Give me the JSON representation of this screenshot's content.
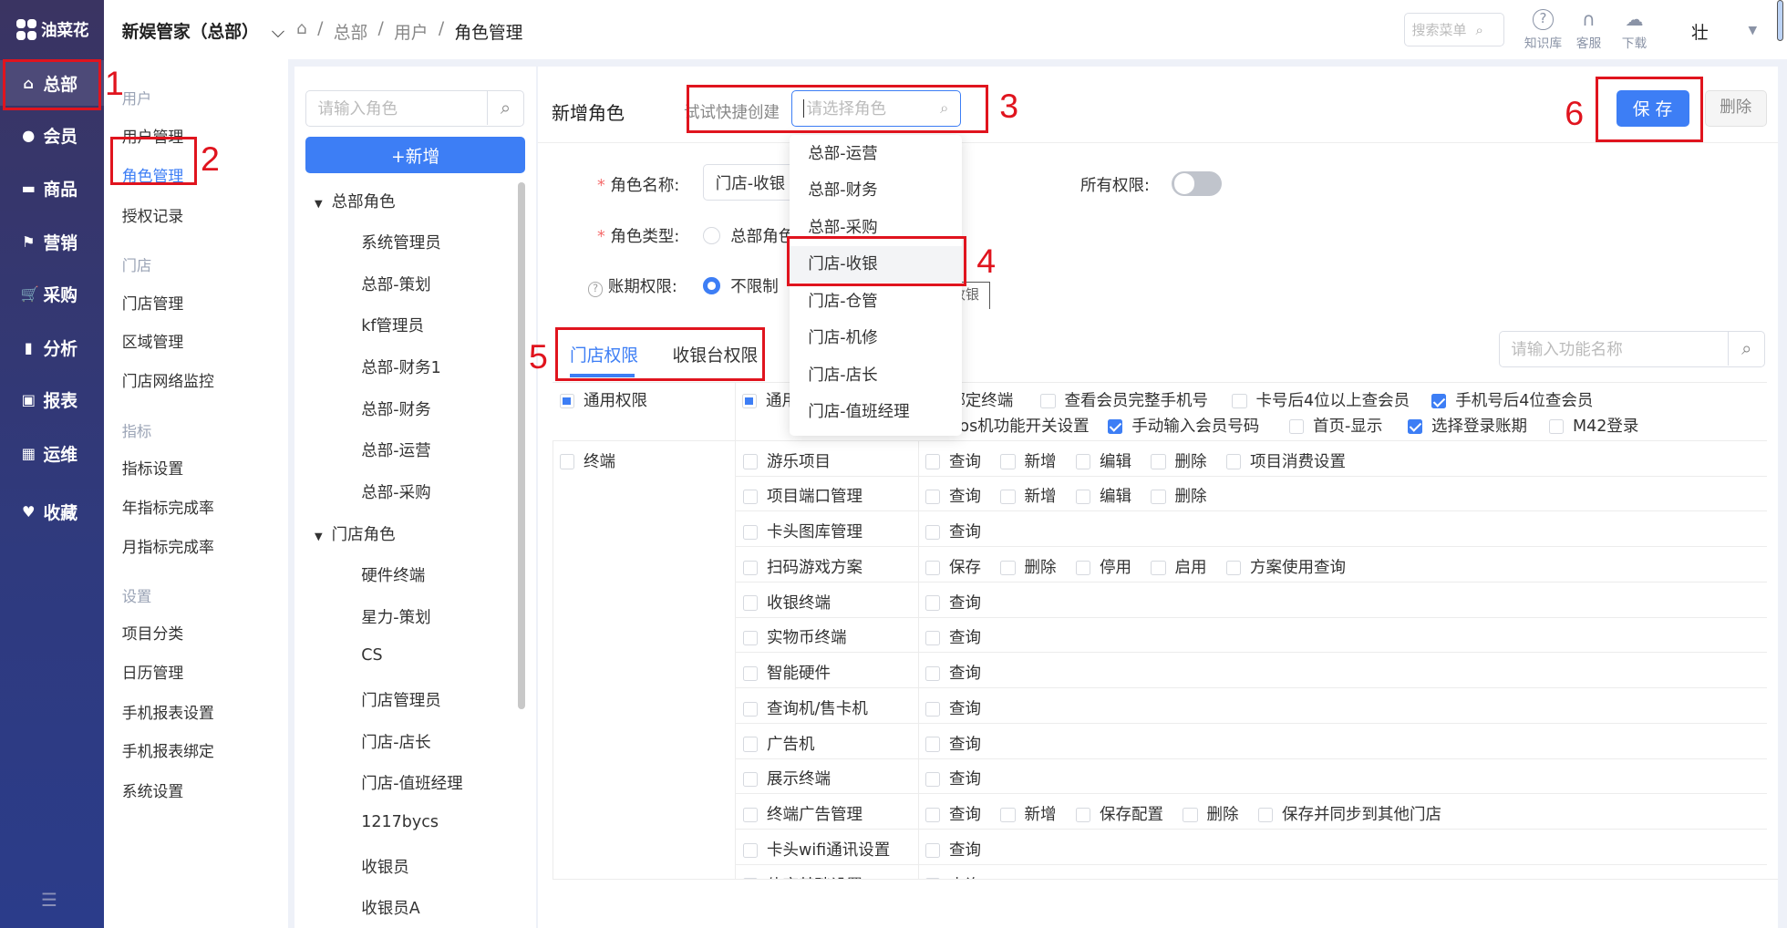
{
  "app": {
    "logo_text": "油菜花",
    "store_title": "新娱管家（总部）"
  },
  "breadcrumb": [
    "总部",
    "用户",
    "角色管理"
  ],
  "topbar": {
    "search_placeholder": "搜索菜单",
    "icons": [
      {
        "icon": "help-circle-icon",
        "label": "知识库"
      },
      {
        "icon": "headset-icon",
        "label": "客服"
      },
      {
        "icon": "cloud-download-icon",
        "label": "下载"
      }
    ],
    "user": "壮"
  },
  "sidebar": [
    {
      "icon": "home-icon",
      "label": "总部",
      "active": true
    },
    {
      "icon": "user-icon",
      "label": "会员"
    },
    {
      "icon": "card-icon",
      "label": "商品"
    },
    {
      "icon": "flag-icon",
      "label": "营销"
    },
    {
      "icon": "cart-icon",
      "label": "采购"
    },
    {
      "icon": "bar-chart-icon",
      "label": "分析"
    },
    {
      "icon": "report-icon",
      "label": "报表"
    },
    {
      "icon": "layout-icon",
      "label": "运维"
    },
    {
      "icon": "heart-icon",
      "label": "收藏"
    }
  ],
  "submenu": [
    {
      "group": "用户",
      "items": [
        "用户管理",
        "角色管理",
        "授权记录"
      ]
    },
    {
      "group": "门店",
      "items": [
        "门店管理",
        "区域管理",
        "门店网络监控"
      ]
    },
    {
      "group": "指标",
      "items": [
        "指标设置",
        "年指标完成率",
        "月指标完成率"
      ]
    },
    {
      "group": "设置",
      "items": [
        "项目分类",
        "日历管理",
        "手机报表设置",
        "手机报表绑定",
        "系统设置"
      ]
    }
  ],
  "submenu_active": "角色管理",
  "roles": {
    "search_placeholder": "请输入角色",
    "add_label": "+新增",
    "groups": [
      {
        "name": "总部角色",
        "items": [
          "系统管理员",
          "总部-策划",
          "kf管理员",
          "总部-财务1",
          "总部-财务",
          "总部-运营",
          "总部-采购"
        ]
      },
      {
        "name": "门店角色",
        "items": [
          "硬件终端",
          "星力-策划",
          "CS",
          "门店管理员",
          "门店-店长",
          "门店-值班经理",
          "1217bycs",
          "收银员",
          "收银员A"
        ]
      }
    ]
  },
  "form": {
    "title": "新增角色",
    "quick_label": "试试快捷创建",
    "quick_placeholder": "请选择角色",
    "save": "保 存",
    "delete": "删除",
    "name_label": "角色名称:",
    "name_value": "门店-收银",
    "type_label": "角色类型:",
    "type_option": "总部角色",
    "period_label": "账期权限:",
    "period_option": "不限制",
    "all_label": "所有权限:",
    "all_on": false,
    "tooltip": "门店-收银"
  },
  "dropdown": {
    "items": [
      "总部-运营",
      "总部-财务",
      "总部-采购",
      "门店-收银",
      "门店-仓管",
      "门店-机修",
      "门店-店长",
      "门店-值班经理"
    ],
    "highlighted": "门店-收银"
  },
  "tabs": {
    "items": [
      "门店权限",
      "收银台权限"
    ],
    "active": "门店权限",
    "search_placeholder": "请输入功能名称"
  },
  "general": {
    "col1": "通用权限",
    "col2": "通用",
    "line1": [
      {
        "t": "绑定终端",
        "c": false
      },
      {
        "t": "查看会员完整手机号",
        "c": false
      },
      {
        "t": "卡号后4位以上查会员",
        "c": false
      },
      {
        "t": "手机号后4位查会员",
        "c": true
      }
    ],
    "line2": [
      {
        "t": "pos机功能开关设置",
        "c": false
      },
      {
        "t": "手动输入会员号码",
        "c": true
      },
      {
        "t": "首页-显示",
        "c": false
      },
      {
        "t": "选择登录账期",
        "c": true
      },
      {
        "t": "M42登录",
        "c": false
      }
    ]
  },
  "terminal": {
    "group": "终端",
    "rows": [
      {
        "name": "游乐项目",
        "perms": [
          "查询",
          "新增",
          "编辑",
          "删除",
          "项目消费设置"
        ]
      },
      {
        "name": "项目端口管理",
        "perms": [
          "查询",
          "新增",
          "编辑",
          "删除"
        ]
      },
      {
        "name": "卡头图库管理",
        "perms": [
          "查询"
        ]
      },
      {
        "name": "扫码游戏方案",
        "perms": [
          "保存",
          "删除",
          "停用",
          "启用",
          "方案使用查询"
        ]
      },
      {
        "name": "收银终端",
        "perms": [
          "查询"
        ]
      },
      {
        "name": "实物币终端",
        "perms": [
          "查询"
        ]
      },
      {
        "name": "智能硬件",
        "perms": [
          "查询"
        ]
      },
      {
        "name": "查询机/售卡机",
        "perms": [
          "查询"
        ]
      },
      {
        "name": "广告机",
        "perms": [
          "查询"
        ]
      },
      {
        "name": "展示终端",
        "perms": [
          "查询"
        ]
      },
      {
        "name": "终端广告管理",
        "perms": [
          "查询",
          "新增",
          "保存配置",
          "删除",
          "保存并同步到其他门店"
        ]
      },
      {
        "name": "卡头wifi通讯设置",
        "perms": [
          "查询"
        ]
      },
      {
        "name": "体育基础设置",
        "perms": [
          "查询"
        ]
      }
    ]
  },
  "annotations": [
    "1",
    "2",
    "3",
    "4",
    "5",
    "6"
  ],
  "colors": {
    "accent": "#3d7ef5",
    "annotation": "#e0141e",
    "sidebar": "#2f3a7e"
  }
}
